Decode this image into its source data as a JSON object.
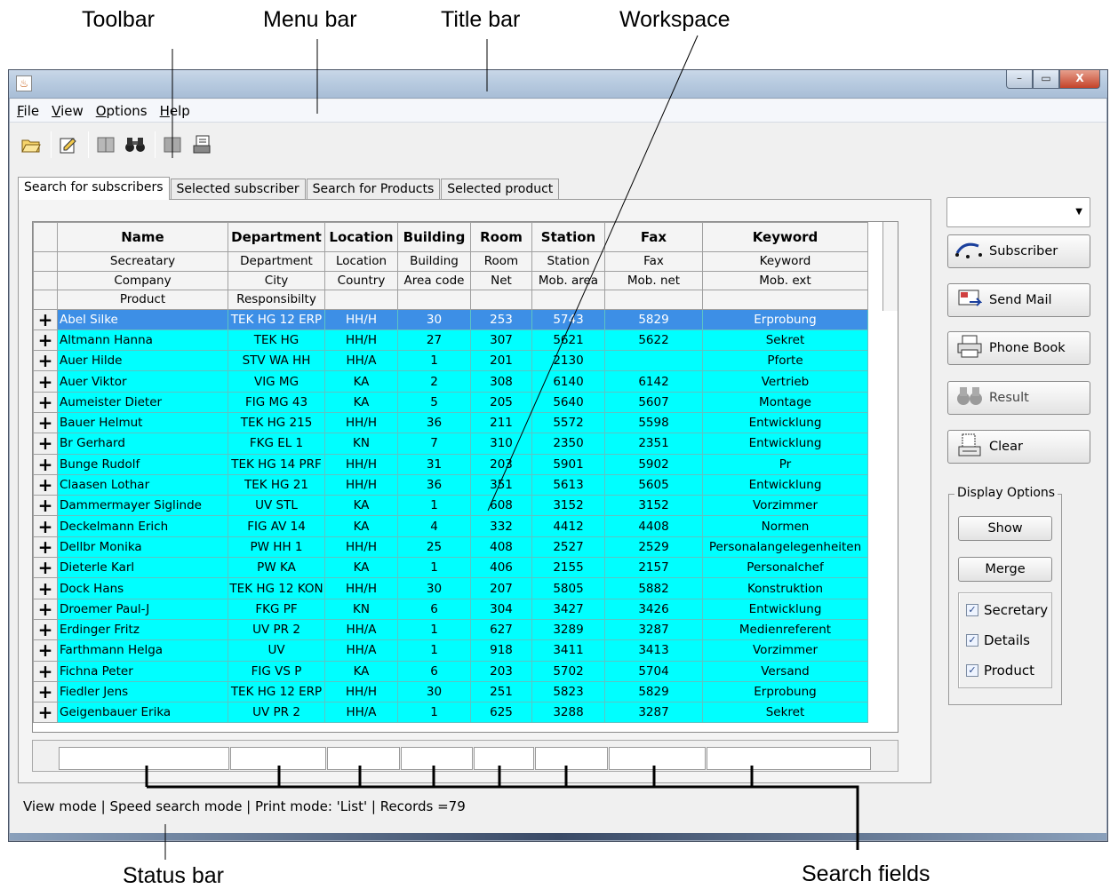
{
  "callouts": {
    "toolbar": "Toolbar",
    "menubar": "Menu bar",
    "titlebar": "Title bar",
    "workspace": "Workspace",
    "statusbar": "Status bar",
    "search_fields": "Search fields"
  },
  "window": {
    "min_glyph": "–",
    "max_glyph": "▭",
    "close_glyph": "X"
  },
  "menu": [
    {
      "label": "File"
    },
    {
      "label": "View"
    },
    {
      "label": "Options"
    },
    {
      "label": "Help"
    }
  ],
  "toolbar_icons": [
    "open-folder-icon",
    "edit-icon",
    "book-icon",
    "binoculars-icon",
    "book-icon",
    "print-form-icon"
  ],
  "tabs": [
    {
      "label": "Search for subscribers",
      "active": true
    },
    {
      "label": "Selected subscriber"
    },
    {
      "label": "Search for Products"
    },
    {
      "label": "Selected product"
    }
  ],
  "table": {
    "columns": [
      "Name",
      "Department",
      "Location",
      "Building",
      "Room",
      "Station",
      "Fax",
      "Keyword"
    ],
    "subheader1": [
      "Secreatary",
      "Department",
      "Location",
      "Building",
      "Room",
      "Station",
      "Fax",
      "Keyword"
    ],
    "subheader2": [
      "Company",
      "City",
      "Country",
      "Area code",
      "Net",
      "Mob. area",
      "Mob. net",
      "Mob. ext"
    ],
    "subheader3": [
      "Product",
      "Responsibilty",
      "",
      "",
      "",
      "",
      "",
      ""
    ],
    "expand_glyph": "+",
    "rows": [
      [
        "Abel Silke",
        "TEK HG 12 ERP",
        "HH/H",
        "30",
        "253",
        "5743",
        "5829",
        "Erprobung"
      ],
      [
        "Altmann Hanna",
        "TEK HG",
        "HH/H",
        "27",
        "307",
        "5621",
        "5622",
        "Sekret"
      ],
      [
        "Auer Hilde",
        "STV WA HH",
        "HH/A",
        "1",
        "201",
        "2130",
        "",
        "Pforte"
      ],
      [
        "Auer Viktor",
        "VIG MG",
        "KA",
        "2",
        "308",
        "6140",
        "6142",
        "Vertrieb"
      ],
      [
        "Aumeister Dieter",
        "FIG MG 43",
        "KA",
        "5",
        "205",
        "5640",
        "5607",
        "Montage"
      ],
      [
        "Bauer Helmut",
        "TEK HG 215",
        "HH/H",
        "36",
        "211",
        "5572",
        "5598",
        "Entwicklung"
      ],
      [
        "Br Gerhard",
        "FKG EL 1",
        "KN",
        "7",
        "310",
        "2350",
        "2351",
        "Entwicklung"
      ],
      [
        "Bunge Rudolf",
        "TEK HG 14 PRF",
        "HH/H",
        "31",
        "203",
        "5901",
        "5902",
        "Pr"
      ],
      [
        "Claasen Lothar",
        "TEK HG 21",
        "HH/H",
        "36",
        "351",
        "5613",
        "5605",
        "Entwicklung"
      ],
      [
        "Dammermayer Siglinde",
        "UV STL",
        "KA",
        "1",
        "608",
        "3152",
        "3152",
        "Vorzimmer"
      ],
      [
        "Deckelmann Erich",
        "FIG AV 14",
        "KA",
        "4",
        "332",
        "4412",
        "4408",
        "Normen"
      ],
      [
        "Dellbr Monika",
        "PW HH 1",
        "HH/H",
        "25",
        "408",
        "2527",
        "2529",
        "Personalangelegenheiten"
      ],
      [
        "Dieterle Karl",
        "PW KA",
        "KA",
        "1",
        "406",
        "2155",
        "2157",
        "Personalchef"
      ],
      [
        "Dock Hans",
        "TEK HG 12 KON",
        "HH/H",
        "30",
        "207",
        "5805",
        "5882",
        "Konstruktion"
      ],
      [
        "Droemer Paul-J",
        "FKG PF",
        "KN",
        "6",
        "304",
        "3427",
        "3426",
        "Entwicklung"
      ],
      [
        "Erdinger Fritz",
        "UV PR 2",
        "HH/A",
        "1",
        "627",
        "3289",
        "3287",
        "Medienreferent"
      ],
      [
        "Farthmann Helga",
        "UV",
        "HH/A",
        "1",
        "918",
        "3411",
        "3413",
        "Vorzimmer"
      ],
      [
        "Fichna Peter",
        "FIG VS P",
        "KA",
        "6",
        "203",
        "5702",
        "5704",
        "Versand"
      ],
      [
        "Fiedler Jens",
        "TEK HG 12 ERP",
        "HH/H",
        "30",
        "251",
        "5823",
        "5829",
        "Erprobung"
      ],
      [
        "Geigenbauer Erika",
        "UV PR 2",
        "HH/A",
        "1",
        "625",
        "3288",
        "3287",
        "Sekret"
      ]
    ],
    "selected_row": 0
  },
  "status": "View mode  |  Speed search mode  |  Print mode: 'List'  |  Records =79",
  "side": {
    "combo_value": "",
    "subscriber": "Subscriber",
    "send_mail": "Send Mail",
    "phone_book": "Phone Book",
    "result": "Result",
    "clear": "Clear",
    "display_options": "Display Options",
    "show": "Show",
    "merge": "Merge",
    "checks": [
      {
        "label": "Secretary",
        "checked": true
      },
      {
        "label": "Details",
        "checked": true
      },
      {
        "label": "Product",
        "checked": true
      }
    ]
  }
}
